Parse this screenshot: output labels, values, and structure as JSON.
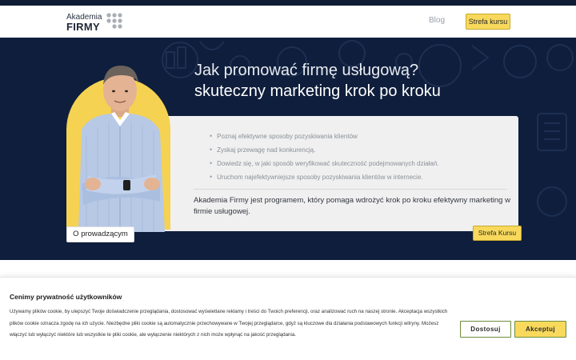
{
  "brand": {
    "line1": "Akademia",
    "line2": "FIRMY",
    "accent": "#f8d95c",
    "dark": "#0f1e3c"
  },
  "nav": {
    "blog": "Blog",
    "strefa": "Strefa kursu"
  },
  "hero": {
    "title_line1": "Jak promować firmę usługową?",
    "title_line2": "skuteczny marketing krok po kroku",
    "bullets": [
      "Poznaj efektywne sposoby pozyskiwania klientów",
      "Zyskaj przewagę nad konkurencją.",
      "Dowiedz się, w jaki sposób weryfikować skuteczność podejmowanych działań.",
      "Uruchom najefektywniejsze sposoby pozyskiwania klientów w internecie."
    ],
    "description": "Akademia Firmy jest programem, który pomaga wdrożyć krok po kroku efektywny marketing w firmie usługowej.",
    "about_button": "O prowadzącym",
    "strefa_button": "Strefa Kursu"
  },
  "cookie": {
    "title": "Cenimy prywatność użytkowników",
    "text": "Używamy plików cookie, by ulepszyć Twoje doświadczenie przeglądania, dostosować wyświetlane reklamy i treści do Twoich preferencji, oraz analizować ruch na naszej stronie. Akceptacja wszystkich plików cookie oznacza zgodę na ich użycie. Niezbędne pliki cookie są automatycznie przechowywane w Twojej przeglądarce, gdyż są kluczowe dla działania podstawowych funkcji witryny. Możesz włączyć lub wyłączyć niektóre lub wszystkie te pliki cookie, ale wyłączenie niektórych z nich może wpłynąć na jakość przeglądania.",
    "customize": "Dostosuj",
    "accept": "Akceptuj"
  }
}
